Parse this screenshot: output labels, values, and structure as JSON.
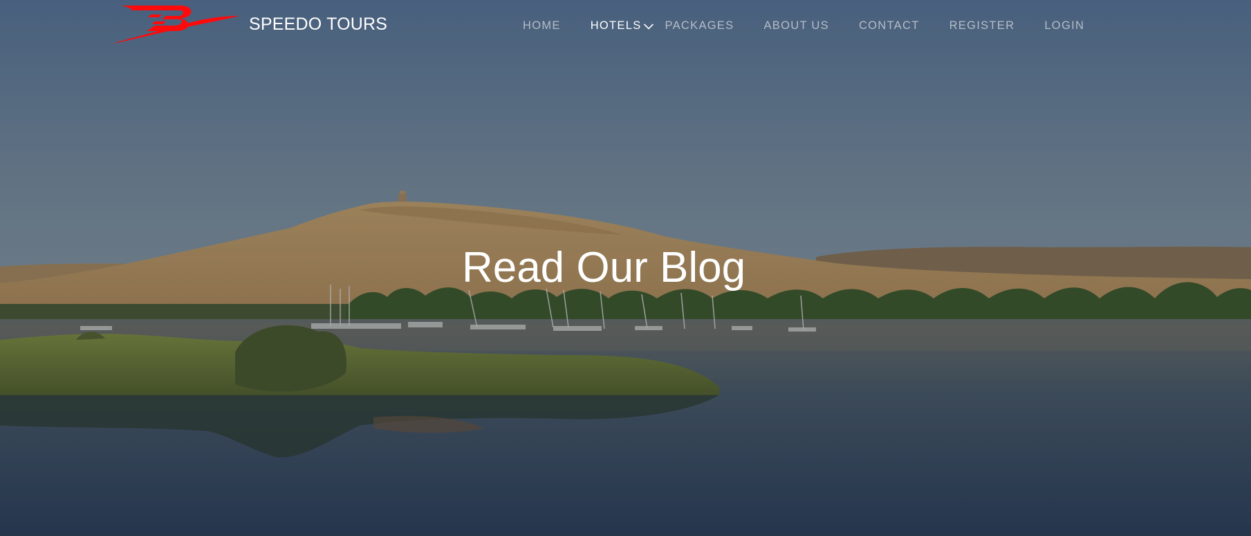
{
  "brand": {
    "name": "SPEEDO TOURS",
    "logo_color": "#ff0a0a"
  },
  "nav": {
    "items": [
      {
        "label": "HOME",
        "active": false
      },
      {
        "label": "HOTELS",
        "active": true,
        "has_dropdown": true,
        "dropdown_icon": "chevron-down-icon"
      },
      {
        "label": "PACKAGES",
        "active": false
      },
      {
        "label": "ABOUT US",
        "active": false
      },
      {
        "label": "CONTACT",
        "active": false
      },
      {
        "label": "REGISTER",
        "active": false
      },
      {
        "label": "LOGIN",
        "active": false
      }
    ]
  },
  "hero": {
    "title": "Read Our Blog",
    "background": "nile-river-desert-landscape-photo"
  },
  "colors": {
    "nav_text": "#b6bdc7",
    "nav_active": "#ffffff",
    "title": "#ffffff",
    "accent": "#ff0a0a"
  }
}
